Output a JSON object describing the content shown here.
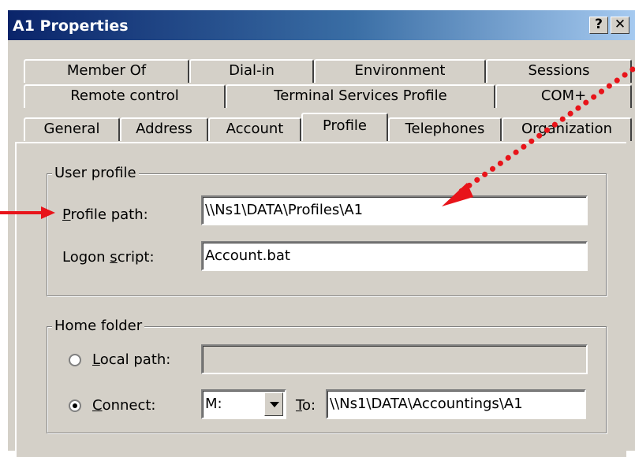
{
  "window": {
    "title": "A1 Properties",
    "help_label": "?",
    "close_label": "✕"
  },
  "tabs": {
    "row1": [
      "Member Of",
      "Dial-in",
      "Environment",
      "Sessions"
    ],
    "row2": [
      "Remote control",
      "Terminal Services Profile",
      "COM+"
    ],
    "row3": [
      "General",
      "Address",
      "Account",
      "Profile",
      "Telephones",
      "Organization"
    ],
    "active": "Profile"
  },
  "user_profile": {
    "legend": "User profile",
    "profile_path": {
      "mnemonic": "P",
      "label_rest": "rofile path:",
      "value": "\\\\Ns1\\DATA\\Profiles\\A1"
    },
    "logon_script": {
      "label_pre": "Logon ",
      "mnemonic": "s",
      "label_post": "cript:",
      "value": "Account.bat"
    }
  },
  "home_folder": {
    "legend": "Home folder",
    "local_path": {
      "mnemonic": "L",
      "label_rest": "ocal path:",
      "value": "",
      "selected": false
    },
    "connect": {
      "mnemonic": "C",
      "label_rest": "onnect:",
      "selected": true,
      "drive": "M:",
      "to_mnemonic": "T",
      "to_rest": "o:",
      "path": "\\\\Ns1\\DATA\\Accountings\\A1"
    }
  },
  "annotation": {
    "arrow_color": "#e8141a"
  }
}
